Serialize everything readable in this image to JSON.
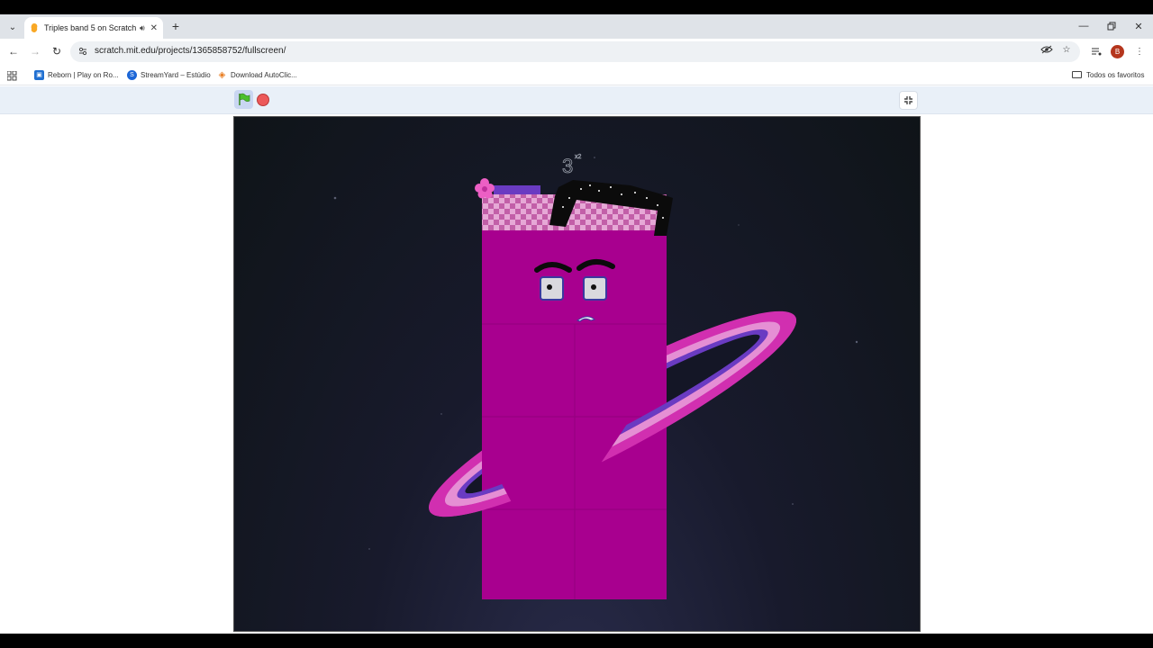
{
  "browser": {
    "tab": {
      "title": "Triples band 5 on Scratch",
      "audio_icon": "speaker-icon",
      "close_icon": "close-icon"
    },
    "new_tab_icon": "plus-icon",
    "window_controls": [
      "minimize-icon",
      "restore-icon",
      "close-icon"
    ],
    "url": "scratch.mit.edu/projects/1365858752/fullscreen/",
    "avatar_letter": "B",
    "bookmarks": [
      {
        "label": "Reborn | Play on Ro...",
        "icon": "reborn-favicon",
        "color": "#1f6fd1"
      },
      {
        "label": "StreamYard – Estúdio",
        "icon": "streamyard-favicon",
        "color": "#1c66d6"
      },
      {
        "label": "Download AutoClic...",
        "icon": "autoclicker-favicon",
        "color": "#e87a1c"
      }
    ],
    "all_bookmarks_label": "Todos os favoritos"
  },
  "scratch": {
    "green_flag_icon": "green-flag-icon",
    "stop_icon": "stop-sign-icon",
    "fullscreen_exit_icon": "exit-fullscreen-icon",
    "stage": {
      "character_label": "3",
      "character_label_superscript": "x2",
      "colors": {
        "body": "#a8008f",
        "ring_outer": "#e23ab8",
        "ring_inner": "#7a3fc4",
        "hair": "#0b0b0b",
        "background": "#111822"
      }
    }
  }
}
